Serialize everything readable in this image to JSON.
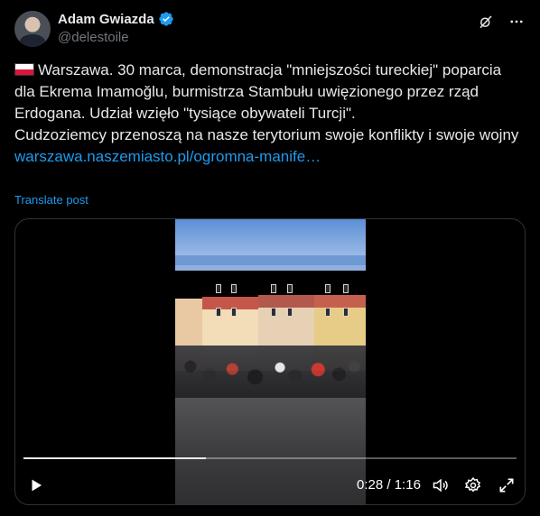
{
  "author": {
    "display_name": "Adam Gwiazda",
    "handle": "@delestoile",
    "verified": true
  },
  "post": {
    "line1": "Warszawa. 30 marca, demonstracja \"mniejszości tureckiej\" poparcia dla Ekrema Imamoğlu, burmistrza Stambułu uwięzionego przez rząd Erdogana. Udział wzięło \"tysiące obywateli Turcji\".",
    "line2": "Cudzoziemcy przenoszą na nasze terytorium swoje konflikty i swoje wojny",
    "link": "warszawa.naszemiasto.pl/ogromna-manife…",
    "translate_label": "Translate post",
    "flag_icon": "poland-flag-icon"
  },
  "video": {
    "current_time": "0:28",
    "separator": "/",
    "duration": "1:16",
    "progress": 0.37
  },
  "colors": {
    "background": "#000000",
    "text": "#e7e9ea",
    "secondary": "#71767b",
    "accent": "#1d9bf0"
  }
}
